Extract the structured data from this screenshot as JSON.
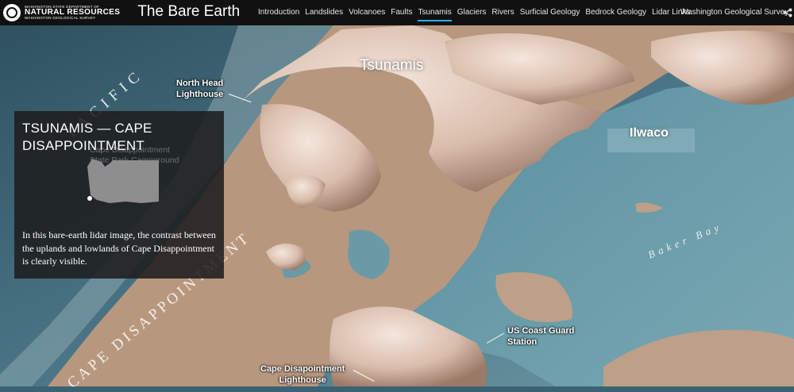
{
  "header": {
    "logo_small": "WASHINGTON STATE DEPARTMENT OF",
    "logo_big": "NATURAL RESOURCES",
    "logo_sub": "WASHINGTON GEOLOGICAL SURVEY",
    "title": "The Bare Earth",
    "nav": [
      {
        "label": "Introduction"
      },
      {
        "label": "Landslides"
      },
      {
        "label": "Volcanoes"
      },
      {
        "label": "Faults"
      },
      {
        "label": "Tsunamis"
      },
      {
        "label": "Glaciers"
      },
      {
        "label": "Rivers"
      },
      {
        "label": "Surficial Geology"
      },
      {
        "label": "Bedrock Geology"
      },
      {
        "label": "Lidar Links"
      }
    ],
    "active_nav": "Tsunamis",
    "org_link": "Washington Geological Survey",
    "share_icon": "share-icon",
    "accent_color": "#29aef0"
  },
  "map": {
    "title": "Tsunamis",
    "labels": {
      "north_head": "North Head\nLighthouse",
      "ilwaco": "Ilwaco",
      "baker_bay": "Baker Bay",
      "coast_guard": "US Coast Guard\nStation",
      "cape_lighthouse": "Cape Disapointment\nLighthouse",
      "cape_region": "CAPE DISAPPOINTMENT",
      "pacific": "PACIFIC"
    }
  },
  "panel": {
    "title": "TSUNAMIS — CAPE DISAPPOINTMENT",
    "ghost_label": "Cape Disappointment\nState Park Campground",
    "body": "In this bare-earth lidar image, the contrast between the uplands and lowlands of Cape Disappointment is clearly visible."
  }
}
